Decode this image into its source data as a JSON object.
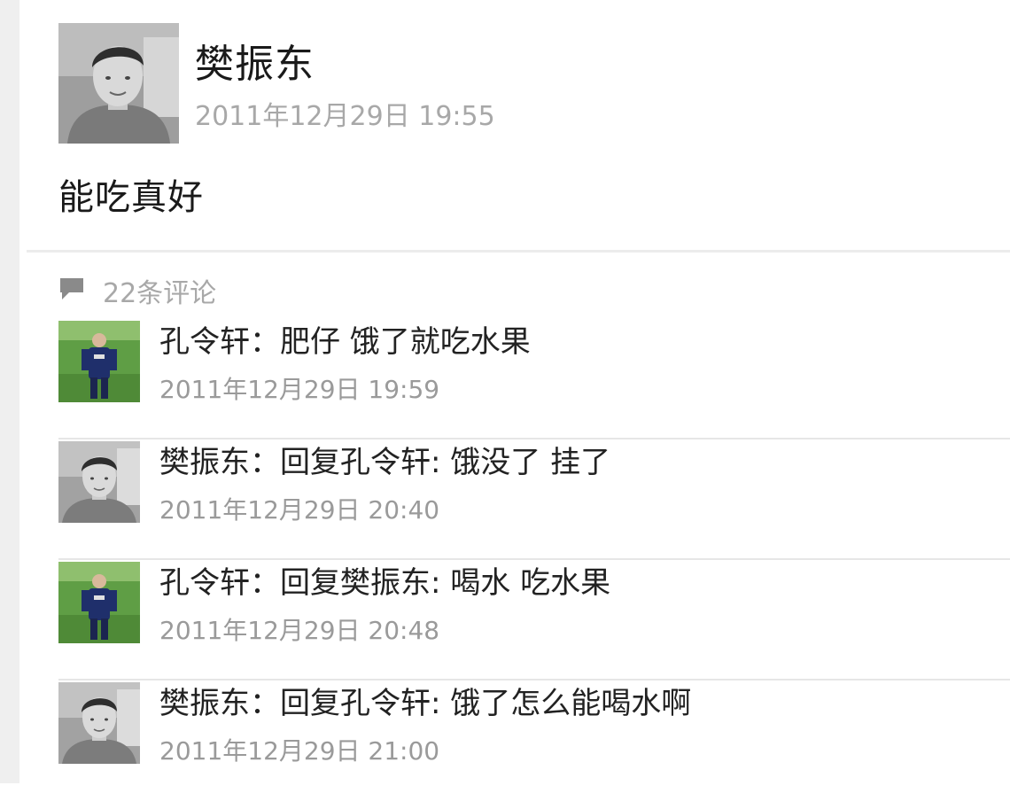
{
  "post": {
    "author": "樊振东",
    "time": "2011年12月29日 19:55",
    "content": "能吃真好",
    "avatar_icon": "person-photo-avatar"
  },
  "comments_section": {
    "icon": "speech-bubble-icon",
    "count_label": "22条评论"
  },
  "comments": [
    {
      "author": "孔令轩",
      "separator": "：",
      "text": "肥仔 饿了就吃水果",
      "time": "2011年12月29日 19:59",
      "avatar_style": "green-field-photo"
    },
    {
      "author": "樊振东",
      "separator": "：",
      "text": "回复孔令轩: 饿没了 挂了",
      "time": "2011年12月29日 20:40",
      "avatar_style": "grayscale-portrait"
    },
    {
      "author": "孔令轩",
      "separator": "：",
      "text": "回复樊振东: 喝水 吃水果",
      "time": "2011年12月29日 20:48",
      "avatar_style": "green-field-photo"
    },
    {
      "author": "樊振东",
      "separator": "：",
      "text": "回复孔令轩: 饿了怎么能喝水啊",
      "time": "2011年12月29日 21:00",
      "avatar_style": "grayscale-portrait"
    }
  ]
}
